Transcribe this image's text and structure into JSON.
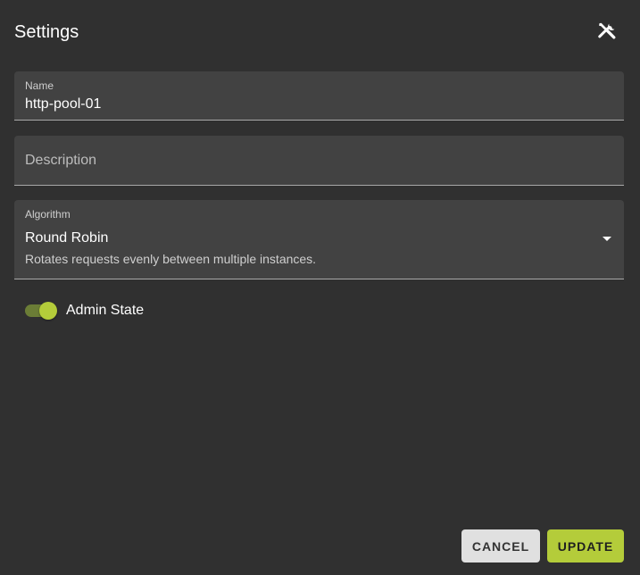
{
  "dialog": {
    "title": "Settings",
    "tools_icon": "build-tools-icon"
  },
  "form": {
    "name": {
      "label": "Name",
      "value": "http-pool-01"
    },
    "description": {
      "placeholder": "Description",
      "value": ""
    },
    "algorithm": {
      "label": "Algorithm",
      "value": "Round Robin",
      "hint": "Rotates requests evenly between multiple instances.",
      "icon": "dropdown-arrow-icon"
    },
    "admin_state": {
      "label": "Admin State",
      "enabled": true
    }
  },
  "actions": {
    "cancel_label": "CANCEL",
    "update_label": "UPDATE"
  },
  "colors": {
    "background": "#303030",
    "field_background": "#424242",
    "accent": "#b4cc3a",
    "toggle_track": "#6b7d36",
    "cancel_button": "#e0e0e0"
  }
}
